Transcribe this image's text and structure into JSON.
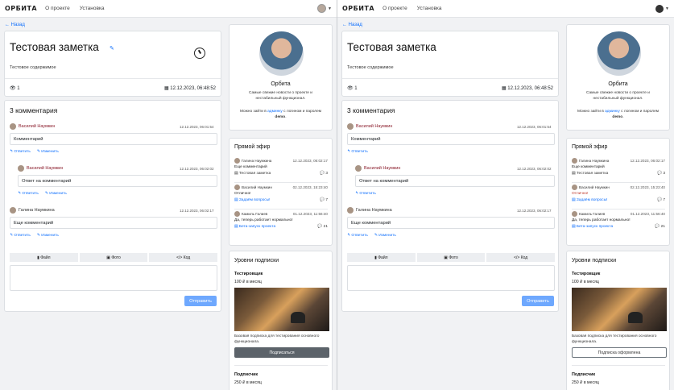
{
  "nav": {
    "logo": "ОРБИТА",
    "links": [
      "О проекте",
      "Установка"
    ]
  },
  "back": "← Назад",
  "note": {
    "title": "Тестовая заметка",
    "body": "Тестовое содержимое",
    "views": "1",
    "date": "12.12.2023, 06:48:52"
  },
  "comments": {
    "heading": "3 комментария",
    "items": [
      {
        "author": "Василий Наумкин",
        "date": "12.12.2023, 06:01:54",
        "text": "Комментарий",
        "reply": "Ответить",
        "edit": "Изменить"
      },
      {
        "author": "Василий Наумкин",
        "date": "12.12.2023, 06:02:02",
        "text": "Ответ на комментарий",
        "reply": "Ответить",
        "edit": "Изменить"
      },
      {
        "author": "Галина Наумкина",
        "date": "12.12.2023, 06:02:17",
        "text": "Еще комментарий",
        "reply": "Ответить",
        "edit": "Изменить"
      }
    ],
    "tools": [
      "Файл",
      "Фото",
      "</> Код"
    ],
    "send": "Отправить"
  },
  "profile": {
    "name": "Орбита",
    "desc": "Самые свежие новости о проекте и нестабильный функционал.",
    "login_pre": "Можно зайти в ",
    "login_link": "админку",
    "login_mid": " с логином и паролем ",
    "login_cred": "demo",
    "login_end": "."
  },
  "live": {
    "heading": "Прямой эфир",
    "items": [
      {
        "author": "Галина Наумкина",
        "date": "12.12.2023, 06:02:17",
        "text": "Еще комментарий",
        "topic": "Тестовая заметка",
        "count": "3"
      },
      {
        "author": "Василий Наумкин",
        "date": "02.12.2023, 15:23:40",
        "text": "Отлично!",
        "topic": "Задаём вопросы!",
        "count": "7"
      },
      {
        "author": "Камиль Галиев",
        "date": "01.12.2023, 11:56:40",
        "text": "Да, теперь работает нормально!",
        "topic": "Бета-запуск проекта",
        "count": "21"
      }
    ]
  },
  "subs": {
    "heading": "Уровни подписки",
    "tier1": "Тестировщик",
    "price1": "100 ₽ в месяц",
    "desc1": "Базовая подписка для тестирования основного функционала.",
    "btn_left": "Подписаться",
    "btn_right": "Подписка оформлена",
    "tier2": "Подписчик",
    "price2": "250 ₽ в месяц"
  }
}
